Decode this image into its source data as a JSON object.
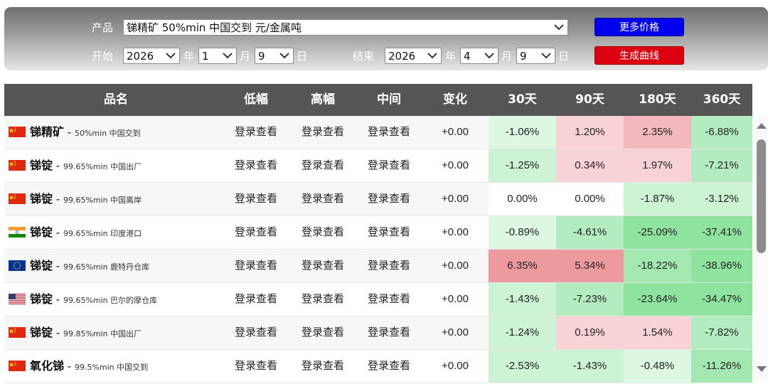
{
  "filters": {
    "product_label": "产品",
    "product_value": "锑精矿 50%min 中国交到 元/金属吨",
    "start_label": "开始",
    "start_year": "2026",
    "start_month": "1",
    "start_day": "9",
    "end_label": "结束",
    "end_year": "2026",
    "end_month": "4",
    "end_day": "9",
    "year_unit": "年",
    "month_unit": "月",
    "day_unit": "日",
    "more_prices_button": "更多价格",
    "generate_curve_button": "生成曲线"
  },
  "table": {
    "headers": [
      "品名",
      "低幅",
      "高幅",
      "中间",
      "变化",
      "30天",
      "90天",
      "180天",
      "360天"
    ],
    "rows": [
      {
        "flag": "china",
        "name": "锑精矿",
        "spec": "50%min 中国交到",
        "low": "登录查看",
        "high": "登录查看",
        "mid": "登录查看",
        "change": "+0.00",
        "d30": "-1.06%",
        "d90": "1.20%",
        "d180": "2.35%",
        "d360": "-6.88%"
      },
      {
        "flag": "china",
        "name": "锑锭",
        "spec": "99.65%min 中国出厂",
        "low": "登录查看",
        "high": "登录查看",
        "mid": "登录查看",
        "change": "+0.00",
        "d30": "-1.25%",
        "d90": "0.34%",
        "d180": "1.97%",
        "d360": "-7.21%"
      },
      {
        "flag": "china",
        "name": "锑锭",
        "spec": "99.65%min 中国离岸",
        "low": "登录查看",
        "high": "登录查看",
        "mid": "登录查看",
        "change": "+0.00",
        "d30": "0.00%",
        "d90": "0.00%",
        "d180": "-1.87%",
        "d360": "-3.12%"
      },
      {
        "flag": "india",
        "name": "锑锭",
        "spec": "99.65%min 印度港口",
        "low": "登录查看",
        "high": "登录查看",
        "mid": "登录查看",
        "change": "+0.00",
        "d30": "-0.89%",
        "d90": "-4.61%",
        "d180": "-25.09%",
        "d360": "-37.41%"
      },
      {
        "flag": "eu",
        "name": "锑锭",
        "spec": "99.65%min 鹿特丹仓库",
        "low": "登录查看",
        "high": "登录查看",
        "mid": "登录查看",
        "change": "+0.00",
        "d30": "6.35%",
        "d90": "5.34%",
        "d180": "-18.22%",
        "d360": "-38.96%"
      },
      {
        "flag": "usa",
        "name": "锑锭",
        "spec": "99.65%min 巴尔的摩仓库",
        "low": "登录查看",
        "high": "登录查看",
        "mid": "登录查看",
        "change": "+0.00",
        "d30": "-1.43%",
        "d90": "-7.23%",
        "d180": "-23.64%",
        "d360": "-34.47%"
      },
      {
        "flag": "china",
        "name": "锑锭",
        "spec": "99.85%min 中国出厂",
        "low": "登录查看",
        "high": "登录查看",
        "mid": "登录查看",
        "change": "+0.00",
        "d30": "-1.24%",
        "d90": "0.19%",
        "d180": "1.54%",
        "d360": "-7.82%"
      },
      {
        "flag": "china",
        "name": "氧化锑",
        "spec": "99.5%min 中国交到",
        "low": "登录查看",
        "high": "登录查看",
        "mid": "登录查看",
        "change": "+0.00",
        "d30": "-2.53%",
        "d90": "-1.43%",
        "d180": "-0.48%",
        "d360": "-11.26%"
      }
    ]
  },
  "colors": {
    "header_bg": "#555555",
    "more_prices_bg": "#0000ee",
    "generate_bg": "#dd0011"
  }
}
